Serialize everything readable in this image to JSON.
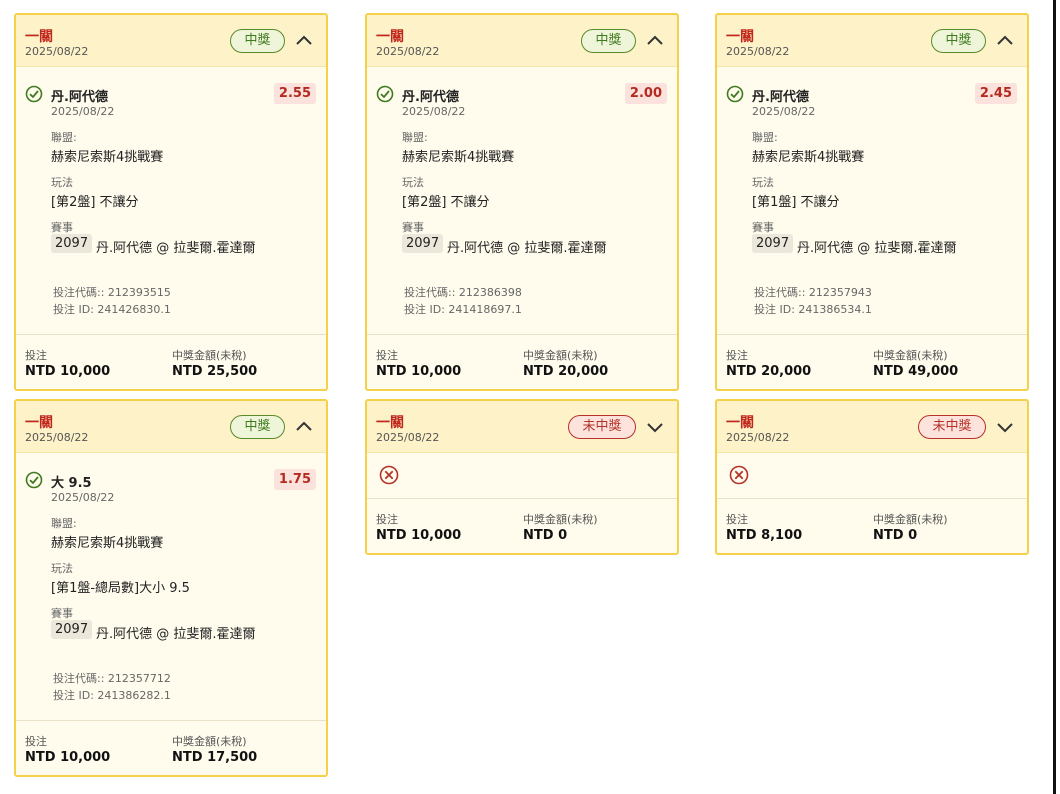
{
  "cards": [
    {
      "header": {
        "title": "一關",
        "date": "2025/08/22",
        "status": "中獎"
      },
      "selection": {
        "name": "丹.阿代德",
        "date": "2025/08/22",
        "odds": "2.55"
      },
      "league_label": "聯盟:",
      "league": "赫索尼索斯4挑戰賽",
      "play_label": "玩法",
      "play": "[第2盤] 不讓分",
      "event_label": "賽事",
      "event_code": "2097",
      "event_name": "丹.阿代德 @ 拉斐爾.霍達爾",
      "bet_code": "投注代碼:: 212393515",
      "bet_id": "投注 ID: 241426830.1",
      "footer": {
        "stake_label": "投注",
        "stake": "NTD 10,000",
        "payout_label": "中獎金額(未稅)",
        "payout": "NTD 25,500"
      }
    },
    {
      "header": {
        "title": "一關",
        "date": "2025/08/22",
        "status": "中獎"
      },
      "selection": {
        "name": "丹.阿代德",
        "date": "2025/08/22",
        "odds": "2.00"
      },
      "league_label": "聯盟:",
      "league": "赫索尼索斯4挑戰賽",
      "play_label": "玩法",
      "play": "[第2盤] 不讓分",
      "event_label": "賽事",
      "event_code": "2097",
      "event_name": "丹.阿代德 @ 拉斐爾.霍達爾",
      "bet_code": "投注代碼:: 212386398",
      "bet_id": "投注 ID: 241418697.1",
      "footer": {
        "stake_label": "投注",
        "stake": "NTD 10,000",
        "payout_label": "中獎金額(未稅)",
        "payout": "NTD 20,000"
      }
    },
    {
      "header": {
        "title": "一關",
        "date": "2025/08/22",
        "status": "中獎"
      },
      "selection": {
        "name": "丹.阿代德",
        "date": "2025/08/22",
        "odds": "2.45"
      },
      "league_label": "聯盟:",
      "league": "赫索尼索斯4挑戰賽",
      "play_label": "玩法",
      "play": "[第1盤] 不讓分",
      "event_label": "賽事",
      "event_code": "2097",
      "event_name": "丹.阿代德 @ 拉斐爾.霍達爾",
      "bet_code": "投注代碼:: 212357943",
      "bet_id": "投注 ID: 241386534.1",
      "footer": {
        "stake_label": "投注",
        "stake": "NTD 20,000",
        "payout_label": "中獎金額(未稅)",
        "payout": "NTD 49,000"
      }
    },
    {
      "header": {
        "title": "一關",
        "date": "2025/08/22",
        "status": "中獎"
      },
      "selection": {
        "name": "大 9.5",
        "date": "2025/08/22",
        "odds": "1.75"
      },
      "league_label": "聯盟:",
      "league": "赫索尼索斯4挑戰賽",
      "play_label": "玩法",
      "play": "[第1盤-總局數]大小 9.5",
      "event_label": "賽事",
      "event_code": "2097",
      "event_name": "丹.阿代德 @ 拉斐爾.霍達爾",
      "bet_code": "投注代碼:: 212357712",
      "bet_id": "投注 ID: 241386282.1",
      "footer": {
        "stake_label": "投注",
        "stake": "NTD 10,000",
        "payout_label": "中獎金額(未稅)",
        "payout": "NTD 17,500"
      }
    },
    {
      "header": {
        "title": "一關",
        "date": "2025/08/22",
        "status": "未中獎"
      },
      "footer": {
        "stake_label": "投注",
        "stake": "NTD 10,000",
        "payout_label": "中獎金額(未稅)",
        "payout": "NTD 0"
      }
    },
    {
      "header": {
        "title": "一關",
        "date": "2025/08/22",
        "status": "未中獎"
      },
      "footer": {
        "stake_label": "投注",
        "stake": "NTD 8,100",
        "payout_label": "中獎金額(未稅)",
        "payout": "NTD 0"
      }
    }
  ],
  "colors": {
    "accent_red": "#c0271c",
    "win_green": "#3f7a1f",
    "card_border": "#f5d04a",
    "header_bg": "#fdf2c8"
  },
  "icons": {
    "expanded": "chevron-up-icon",
    "collapsed": "chevron-down-icon",
    "won": "check-circle-icon",
    "lost": "x-circle-icon"
  }
}
